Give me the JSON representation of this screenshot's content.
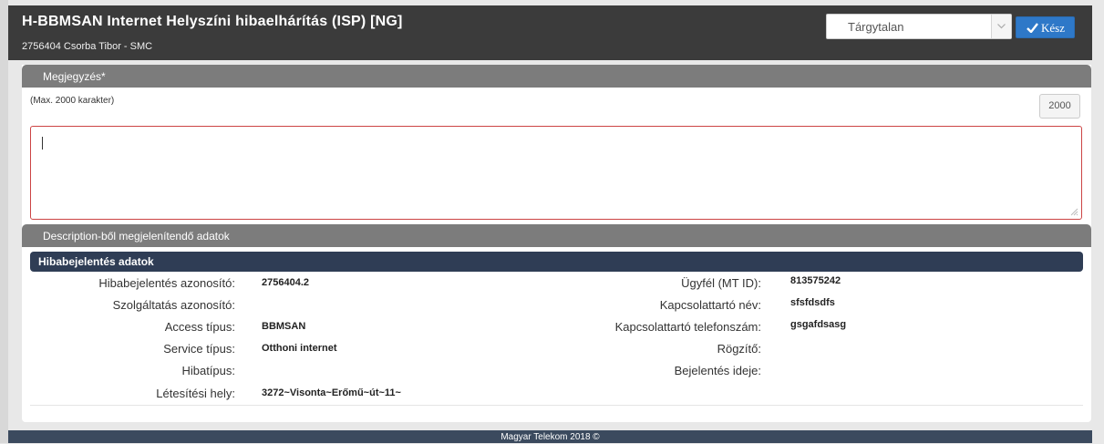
{
  "header": {
    "title": "H-BBMSAN Internet Helyszíni hibaelhárítás (ISP) [NG]",
    "subtitle": "2756404 Csorba Tibor - SMC",
    "status_select": "Tárgytalan",
    "done_label": "Kész"
  },
  "note_section": {
    "title": "Megjegyzés*",
    "max_note": "(Max. 2000 karakter)",
    "counter": "2000",
    "value": ""
  },
  "description_section": {
    "title": "Description-ből megjelenítendő adatok",
    "subheader": "Hibabejelentés adatok",
    "left": [
      {
        "label": "Hibabejelentés azonosító:",
        "value": "2756404.2"
      },
      {
        "label": "Szolgáltatás azonosító:",
        "value": ""
      },
      {
        "label": "Access típus:",
        "value": "BBMSAN"
      },
      {
        "label": "Service típus:",
        "value": "Otthoni internet"
      },
      {
        "label": "Hibatípus:",
        "value": ""
      },
      {
        "label": "Létesítési hely:",
        "value": "3272~Visonta~Erőmű~út~11~"
      }
    ],
    "right": [
      {
        "label": "Ügyfél (MT ID):",
        "value": "813575242"
      },
      {
        "label": "Kapcsolattartó név:",
        "value": "sfsfdsdfs"
      },
      {
        "label": "Kapcsolattartó telefonszám:",
        "value": "gsgafdsasg"
      },
      {
        "label": "Rögzítő:",
        "value": ""
      },
      {
        "label": "Bejelentés ideje:",
        "value": ""
      }
    ]
  },
  "footer": {
    "text": "Magyar Telekom 2018 ©"
  }
}
